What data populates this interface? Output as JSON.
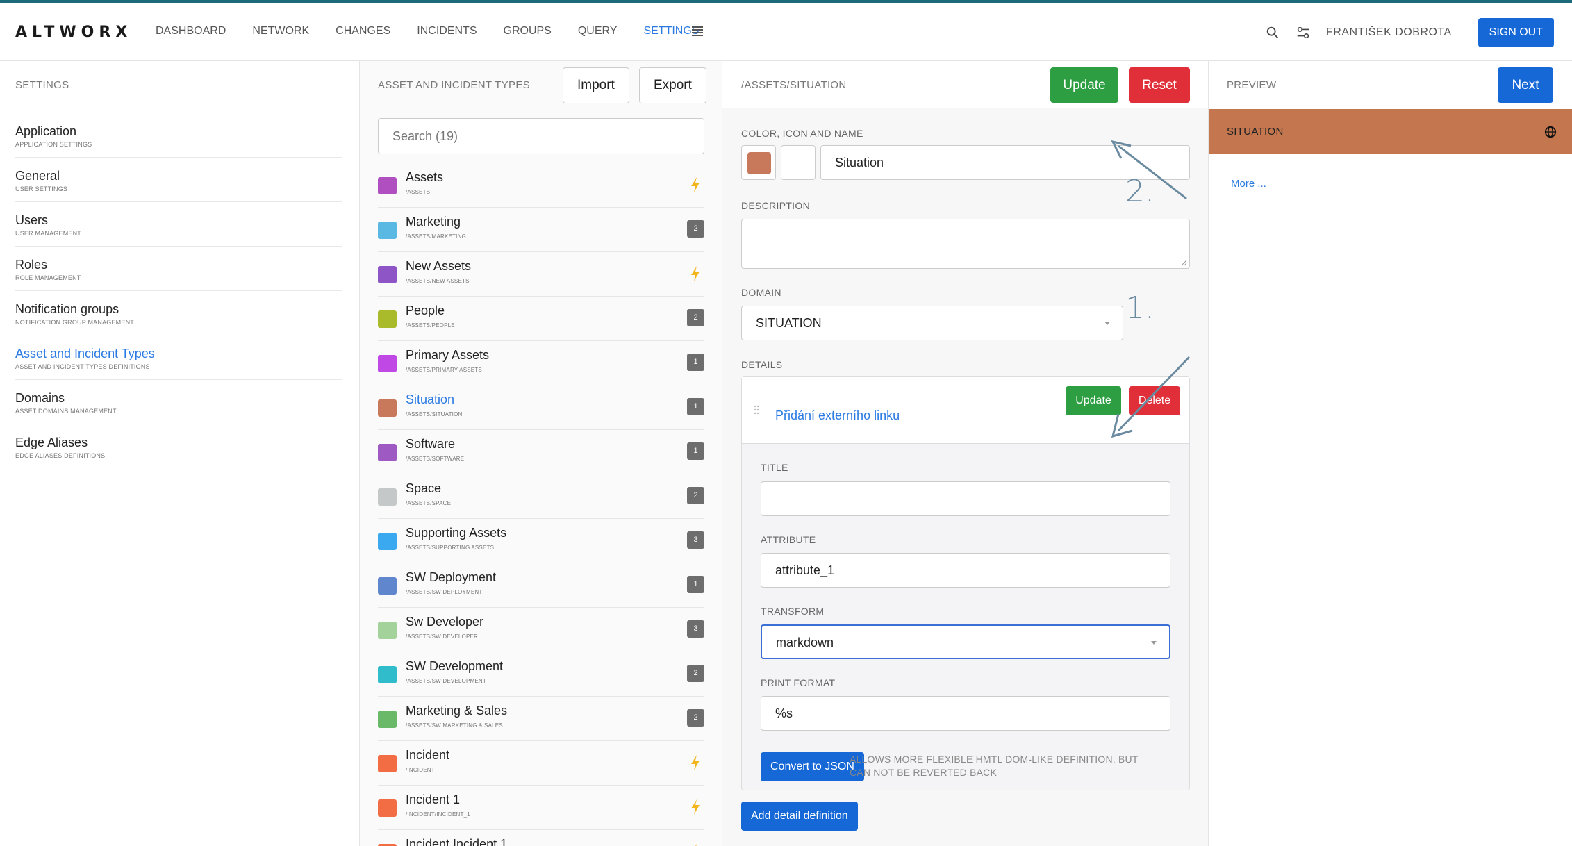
{
  "app": {
    "logo": "ALTWORX"
  },
  "nav": {
    "items": [
      {
        "label": "DASHBOARD",
        "active": false
      },
      {
        "label": "NETWORK",
        "active": false
      },
      {
        "label": "CHANGES",
        "active": false
      },
      {
        "label": "INCIDENTS",
        "active": false
      },
      {
        "label": "GROUPS",
        "active": false
      },
      {
        "label": "QUERY",
        "active": false
      },
      {
        "label": "SETTINGS",
        "active": true
      }
    ],
    "user": "FRANTIŠEK DOBROTA",
    "signout": "SIGN OUT"
  },
  "settings": {
    "title": "SETTINGS",
    "items": [
      {
        "name": "Application",
        "sub": "APPLICATION SETTINGS"
      },
      {
        "name": "General",
        "sub": "USER SETTINGS"
      },
      {
        "name": "Users",
        "sub": "USER MANAGEMENT"
      },
      {
        "name": "Roles",
        "sub": "ROLE MANAGEMENT"
      },
      {
        "name": "Notification groups",
        "sub": "NOTIFICATION GROUP MANAGEMENT"
      },
      {
        "name": "Asset and Incident Types",
        "sub": "ASSET AND INCIDENT TYPES DEFINITIONS"
      },
      {
        "name": "Domains",
        "sub": "ASSET DOMAINS MANAGEMENT"
      },
      {
        "name": "Edge Aliases",
        "sub": "EDGE ALIASES DEFINITIONS"
      }
    ]
  },
  "types": {
    "title": "ASSET AND INCIDENT TYPES",
    "import": "Import",
    "export": "Export",
    "search_placeholder": "Search (19)",
    "items": [
      {
        "name": "Assets",
        "path": "/ASSETS",
        "color": "#b04fc0",
        "badge": "bolt"
      },
      {
        "name": "Marketing",
        "path": "/ASSETS/MARKETING",
        "color": "#5ab9e3",
        "badge": "2"
      },
      {
        "name": "New Assets",
        "path": "/ASSETS/NEW ASSETS",
        "color": "#8e55c6",
        "badge": "bolt"
      },
      {
        "name": "People",
        "path": "/ASSETS/PEOPLE",
        "color": "#a9bb2a",
        "badge": "2"
      },
      {
        "name": "Primary Assets",
        "path": "/ASSETS/PRIMARY ASSETS",
        "color": "#c049e6",
        "badge": "1"
      },
      {
        "name": "Situation",
        "path": "/ASSETS/SITUATION",
        "color": "#c8785b",
        "badge": "1"
      },
      {
        "name": "Software",
        "path": "/ASSETS/SOFTWARE",
        "color": "#9e59c2",
        "badge": "1"
      },
      {
        "name": "Space",
        "path": "/ASSETS/SPACE",
        "color": "#c5c8c8",
        "badge": "2"
      },
      {
        "name": "Supporting Assets",
        "path": "/ASSETS/SUPPORTING ASSETS",
        "color": "#3aa9ef",
        "badge": "3"
      },
      {
        "name": "SW Deployment",
        "path": "/ASSETS/SW DEPLOYMENT",
        "color": "#6087cd",
        "badge": "1"
      },
      {
        "name": "Sw Developer",
        "path": "/ASSETS/SW DEVELOPER",
        "color": "#a3d39a",
        "badge": "3"
      },
      {
        "name": "SW Development",
        "path": "/ASSETS/SW DEVELOPMENT",
        "color": "#31bccb",
        "badge": "2"
      },
      {
        "name": "Marketing & Sales",
        "path": "/ASSETS/SW MARKETING & SALES",
        "color": "#69b969",
        "badge": "2"
      },
      {
        "name": "Incident",
        "path": "/INCIDENT",
        "color": "#f26d44",
        "badge": "bolt"
      },
      {
        "name": "Incident 1",
        "path": "/INCIDENT/INCIDENT_1",
        "color": "#f26d44",
        "badge": "bolt"
      },
      {
        "name": "Incident Incident 1",
        "path": "",
        "color": "#f26d44",
        "badge": "bolt"
      }
    ]
  },
  "editor": {
    "title": "/ASSETS/SITUATION",
    "update": "Update",
    "reset": "Reset",
    "color_icon_name_label": "COLOR, ICON AND NAME",
    "color": "#c8785b",
    "name": "Situation",
    "description_label": "DESCRIPTION",
    "domain_label": "DOMAIN",
    "domain": "SITUATION",
    "details_label": "DETAILS",
    "detail": {
      "link": "Přidání externího linku",
      "update": "Update",
      "delete": "Delete",
      "title_label": "TITLE",
      "title_value": "",
      "attribute_label": "ATTRIBUTE",
      "attribute_value": "attribute_1",
      "transform_label": "TRANSFORM",
      "transform_value": "markdown",
      "print_format_label": "PRINT FORMAT",
      "print_format_value": "%s",
      "convert": "Convert to JSON",
      "hint": "ALLOWS MORE FLEXIBLE HMTL DOM-LIKE DEFINITION, BUT CAN NOT BE REVERTED BACK"
    },
    "add_detail": "Add detail definition",
    "annotation_1": "1.",
    "annotation_2": "2."
  },
  "preview": {
    "title": "PREVIEW",
    "next": "Next",
    "bar_label": "SITUATION",
    "bar_color": "#c4774f",
    "more": "More ..."
  }
}
